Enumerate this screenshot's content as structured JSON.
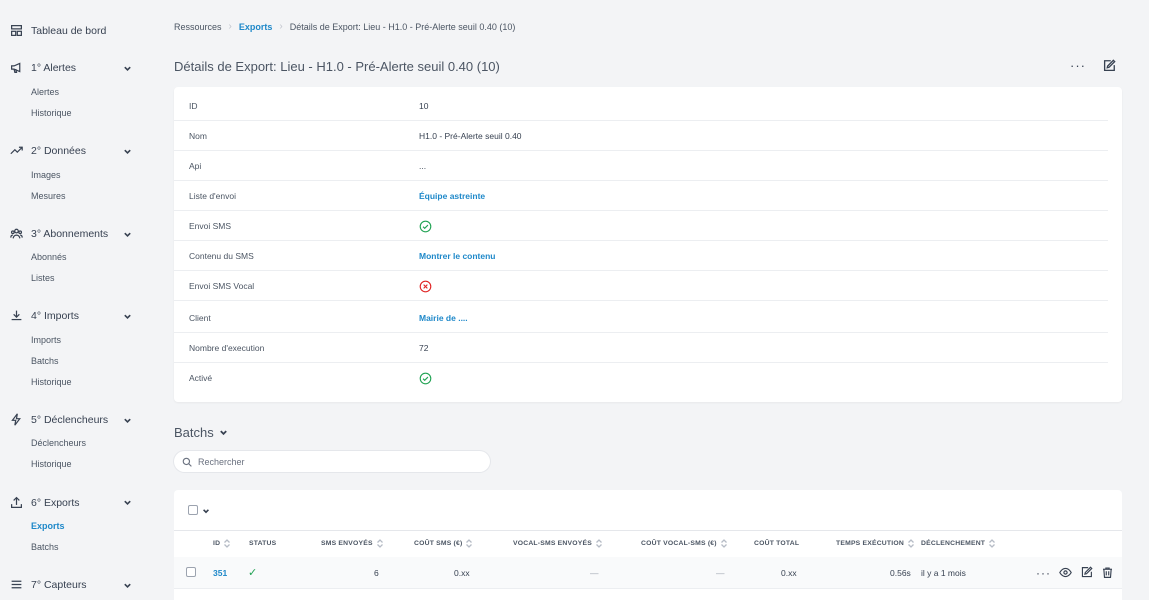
{
  "sidebar": {
    "dashboard": "Tableau de bord",
    "sections": [
      {
        "label": "1° Alertes",
        "icon": "megaphone-icon",
        "items": [
          "Alertes",
          "Historique"
        ]
      },
      {
        "label": "2° Données",
        "icon": "trend-up-icon",
        "items": [
          "Images",
          "Mesures"
        ]
      },
      {
        "label": "3° Abonnements",
        "icon": "users-icon",
        "items": [
          "Abonnés",
          "Listes"
        ]
      },
      {
        "label": "4° Imports",
        "icon": "download-icon",
        "items": [
          "Imports",
          "Batchs",
          "Historique"
        ]
      },
      {
        "label": "5° Déclencheurs",
        "icon": "lightning-icon",
        "items": [
          "Déclencheurs",
          "Historique"
        ]
      },
      {
        "label": "6° Exports",
        "icon": "upload-icon",
        "items": [
          "Exports",
          "Batchs"
        ],
        "active_item": "Exports"
      },
      {
        "label": "7° Capteurs",
        "icon": "list-icon",
        "items": []
      }
    ]
  },
  "breadcrumb": {
    "root": "Ressources",
    "section": "Exports",
    "current": "Détails de Export: Lieu - H1.0 - Pré-Alerte seuil 0.40 (10)"
  },
  "page": {
    "title": "Détails de Export: Lieu - H1.0 - Pré-Alerte seuil 0.40 (10)",
    "more_label": "···"
  },
  "details": [
    {
      "label": "ID",
      "value": "10",
      "type": "text"
    },
    {
      "label": "Nom",
      "value": "H1.0 - Pré-Alerte seuil 0.40",
      "type": "text"
    },
    {
      "label": "Api",
      "value": "...",
      "type": "text"
    },
    {
      "label": "Liste d'envoi",
      "value": "Équipe astreinte",
      "type": "link"
    },
    {
      "label": "Envoi SMS",
      "value": true,
      "type": "bool"
    },
    {
      "label": "Contenu du SMS",
      "value": "Montrer le contenu",
      "type": "link"
    },
    {
      "label": "Envoi SMS Vocal",
      "value": false,
      "type": "bool"
    },
    {
      "label": "Client",
      "value": "Mairie de ....",
      "type": "link"
    },
    {
      "label": "Nombre d'execution",
      "value": "72",
      "type": "text"
    },
    {
      "label": "Activé",
      "value": true,
      "type": "bool"
    }
  ],
  "batches": {
    "title": "Batchs",
    "search_placeholder": "Rechercher",
    "columns": [
      "ID",
      "STATUS",
      "SMS ENVOYÉS",
      "COÛT SMS (€)",
      "VOCAL-SMS ENVOYÉS",
      "COÛT VOCAL-SMS (€)",
      "COÛT TOTAL",
      "TEMPS EXÉCUTION",
      "DÉCLENCHEMENT"
    ],
    "rows": [
      {
        "id": "351",
        "status": "✓",
        "sms_sent": "6",
        "sms_cost": "0.xx",
        "vocal_sent": "—",
        "vocal_cost": "—",
        "total_cost": "0.xx",
        "exec_time": "0.56s",
        "trigger": "il y a 1 mois",
        "more": "···"
      }
    ]
  },
  "colors": {
    "accent": "#1e88c9",
    "success": "#22a354",
    "danger": "#e02424",
    "background": "#f3f4f6"
  }
}
